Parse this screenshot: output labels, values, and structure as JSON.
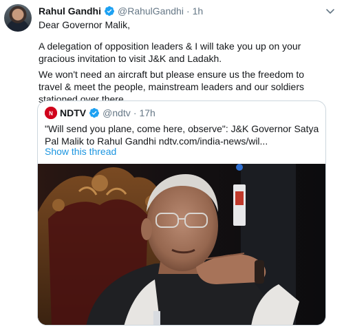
{
  "tweet": {
    "author": {
      "name": "Rahul Gandhi",
      "handle": "@RahulGandhi",
      "separator": "·",
      "time": "1h",
      "avatar_icon": "profile-photo"
    },
    "verified_icon": "verified-badge-icon",
    "menu_icon": "chevron-down-icon",
    "paragraphs": [
      "Dear Governor Malik,",
      "A delegation of opposition leaders & I will take you up on your gracious invitation to visit J&K and Ladakh.",
      "We won't need an aircraft but please ensure us the freedom to travel & meet the people, mainstream leaders and our soldiers stationed over there."
    ],
    "quoted": {
      "name": "NDTV",
      "handle": "@ndtv",
      "separator": "·",
      "time": "17h",
      "text": "\"Will send you plane, come here, observe\": J&K Governor Satya Pal Malik to Rahul Gandhi ndtv.com/india-news/wil...",
      "show_thread": "Show this thread",
      "logo_letter": "N"
    }
  },
  "colors": {
    "verified": "#1da1f2",
    "link": "#1b95e0",
    "secondary_text": "#657786",
    "ndtv_red": "#d0021b",
    "border": "#ccd6dd"
  }
}
